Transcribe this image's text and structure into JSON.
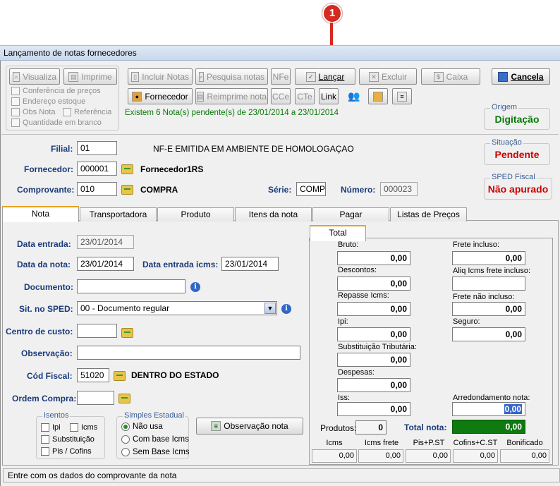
{
  "callout": {
    "number": "1"
  },
  "window": {
    "title": "Lançamento de notas fornecedores"
  },
  "toolbar": {
    "visualiza": "Visualiza",
    "imprime": "Imprime",
    "incluir_notas": "Incluir Notas",
    "pesquisa_notas": "Pesquisa notas",
    "nfe": "NFe",
    "lancar": "Lançar",
    "excluir": "Excluir",
    "caixa": "Caixa",
    "cancela": "Cancela",
    "fornecedor": "Fornecedor",
    "reimprime_nota": "Reimprime nota",
    "cce": "CCe",
    "cte": "CTe",
    "link": "Link"
  },
  "options": {
    "conferencia": "Conferência de preços",
    "endereco": "Endereço estoque",
    "obs_nota": "Obs Nota",
    "referencia": "Referência",
    "quantidade": "Quantidade em branco"
  },
  "pending_message": "Existem 6 Nota(s) pendente(s) de 23/01/2014 a 23/01/2014",
  "origem": {
    "label": "Origem",
    "value": "Digitação"
  },
  "situacao": {
    "label": "Situação",
    "value": "Pendente"
  },
  "sped": {
    "label": "SPED Fiscal",
    "value": "Não apurado"
  },
  "header": {
    "filial_label": "Filial:",
    "filial": "01",
    "env_message": "NF-E EMITIDA EM AMBIENTE DE HOMOLOGAÇAO",
    "fornecedor_label": "Fornecedor:",
    "fornecedor_code": "000001",
    "fornecedor_name": "Fornecedor1RS",
    "comprovante_label": "Comprovante:",
    "comprovante_code": "010",
    "comprovante_name": "COMPRA",
    "serie_label": "Série:",
    "serie": "COMP",
    "numero_label": "Número:",
    "numero": "000023"
  },
  "tabs": [
    "Nota",
    "Transportadora",
    "Produto",
    "Itens da nota",
    "Pagar",
    "Listas de Preços"
  ],
  "nota": {
    "data_entrada_label": "Data entrada:",
    "data_entrada": "23/01/2014",
    "data_nota_label": "Data da nota:",
    "data_nota": "23/01/2014",
    "data_icms_label": "Data entrada icms:",
    "data_icms": "23/01/2014",
    "documento_label": "Documento:",
    "documento": "",
    "sit_sped_label": "Sit. no SPED:",
    "sit_sped": "00 - Documento regular",
    "centro_label": "Centro de custo:",
    "centro": "",
    "observacao_label": "Observação:",
    "observacao": "",
    "cod_fiscal_label": "Cód Fiscal:",
    "cod_fiscal": "51020",
    "cod_fiscal_desc": "DENTRO DO ESTADO",
    "ordem_label": "Ordem Compra:",
    "ordem": ""
  },
  "isentos": {
    "label": "Isentos",
    "ipi": "Ipi",
    "icms": "Icms",
    "substituicao": "Substituição",
    "pis": "Pis / Cofins"
  },
  "simples": {
    "label": "Simples Estadual",
    "nao_usa": "Não usa",
    "com_base": "Com base Icms",
    "sem_base": "Sem Base Icms"
  },
  "obs_nota_button": "Observação nota",
  "total": {
    "tab": "Total",
    "bruto_label": "Bruto:",
    "bruto": "0,00",
    "descontos_label": "Descontos:",
    "descontos": "0,00",
    "repasse_label": "Repasse Icms:",
    "repasse": "0,00",
    "ipi_label": "Ipi:",
    "ipi": "0,00",
    "st_label": "Substituição Tributária:",
    "st": "0,00",
    "despesas_label": "Despesas:",
    "despesas": "0,00",
    "iss_label": "Iss:",
    "iss": "0,00",
    "frete_incluso_label": "Frete incluso:",
    "frete_incluso": "0,00",
    "aliq_label": "Aliq Icms frete incluso:",
    "aliq": "",
    "frete_nao_label": "Frete não incluso:",
    "frete_nao": "0,00",
    "seguro_label": "Seguro:",
    "seguro": "0,00",
    "arred_label": "Arredondamento nota:",
    "arred": "0,00",
    "produtos_label": "Produtos:",
    "produtos": "0",
    "total_nota_label": "Total nota:",
    "total_nota": "0,00"
  },
  "summary": {
    "headers": [
      "Icms",
      "Icms frete",
      "Pis+P.ST",
      "Cofins+C.ST",
      "Bonificado"
    ],
    "values": [
      "0,00",
      "0,00",
      "0,00",
      "0,00",
      "0,00"
    ]
  },
  "status": "Entre com os dados do comprovante da nota",
  "colors": {
    "accent_green": "#0a7a0a",
    "alert_red": "#cc0000",
    "total_green": "#0f7a0f"
  }
}
